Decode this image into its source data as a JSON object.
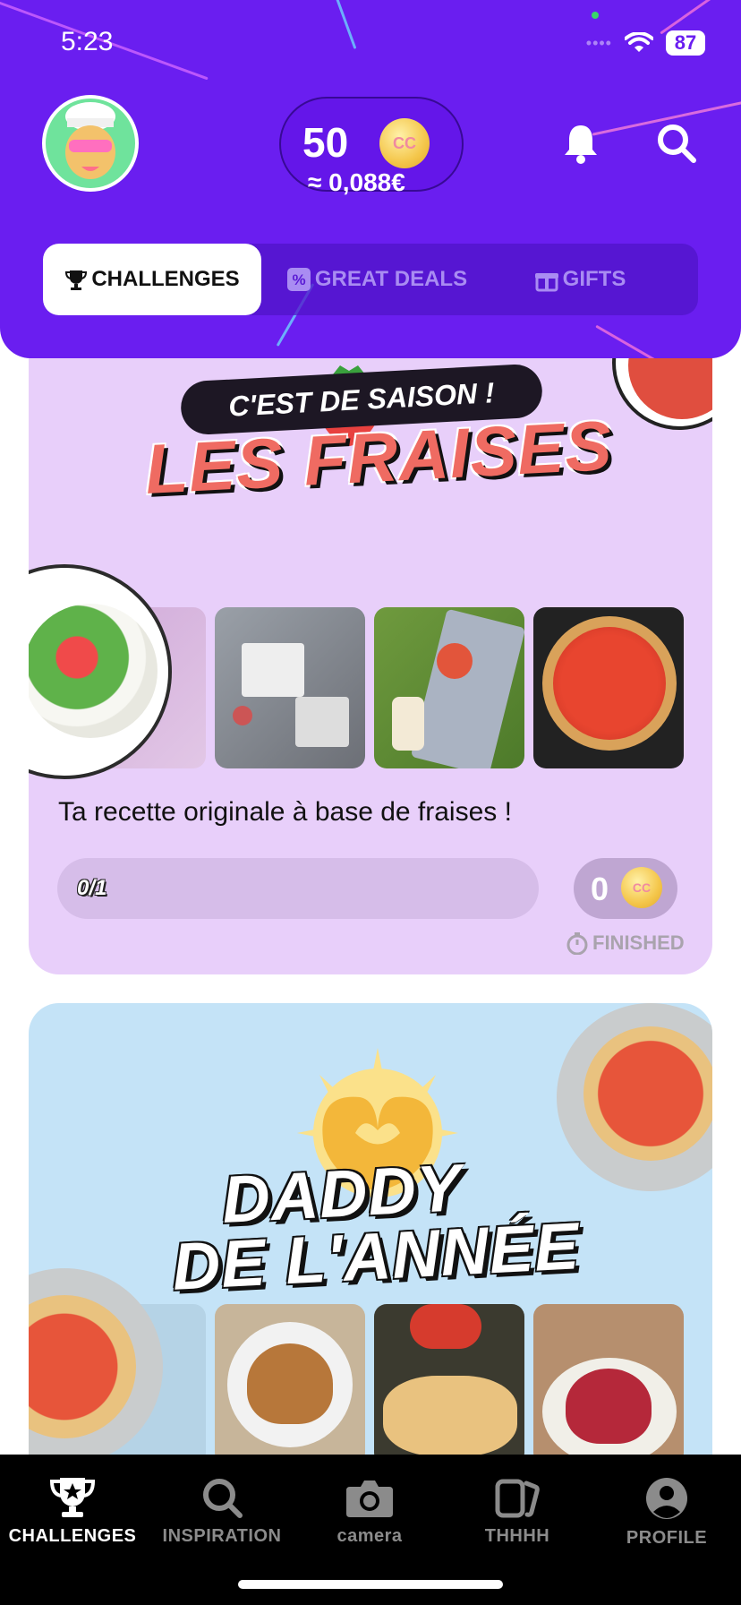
{
  "status_bar": {
    "time": "5:23",
    "battery": "87",
    "signal": "••••"
  },
  "header": {
    "coins": "50",
    "coins_value": "≈ 0,088€",
    "coin_symbol": "CC"
  },
  "tabs": [
    {
      "label": "CHALLENGES",
      "active": true
    },
    {
      "label": "GREAT DEALS",
      "active": false
    },
    {
      "label": "GIFTS",
      "active": false
    }
  ],
  "challenges": [
    {
      "kicker": "C'EST DE SAISON !",
      "title": "LES FRAISES",
      "description": "Ta recette originale à base de fraises !",
      "progress": "0/1",
      "progress_fraction": 0,
      "reward": "0",
      "status": "FINISHED"
    },
    {
      "title_line1": "DADDY",
      "title_line2": "DE L'ANNÉE"
    }
  ],
  "bottom_nav": [
    {
      "label": "CHALLENGES",
      "icon": "trophy-icon",
      "active": true
    },
    {
      "label": "INSPIRATION",
      "icon": "search-icon",
      "active": false
    },
    {
      "label": "camera",
      "icon": "camera-icon",
      "active": false
    },
    {
      "label": "THHHH",
      "icon": "cards-icon",
      "active": false
    },
    {
      "label": "PROFILE",
      "icon": "profile-icon",
      "active": false
    }
  ],
  "colors": {
    "brand_purple": "#6a1ef0",
    "card1_bg": "#e8cffa",
    "card2_bg": "#c4e3f7",
    "title_red": "#ef6b62"
  }
}
